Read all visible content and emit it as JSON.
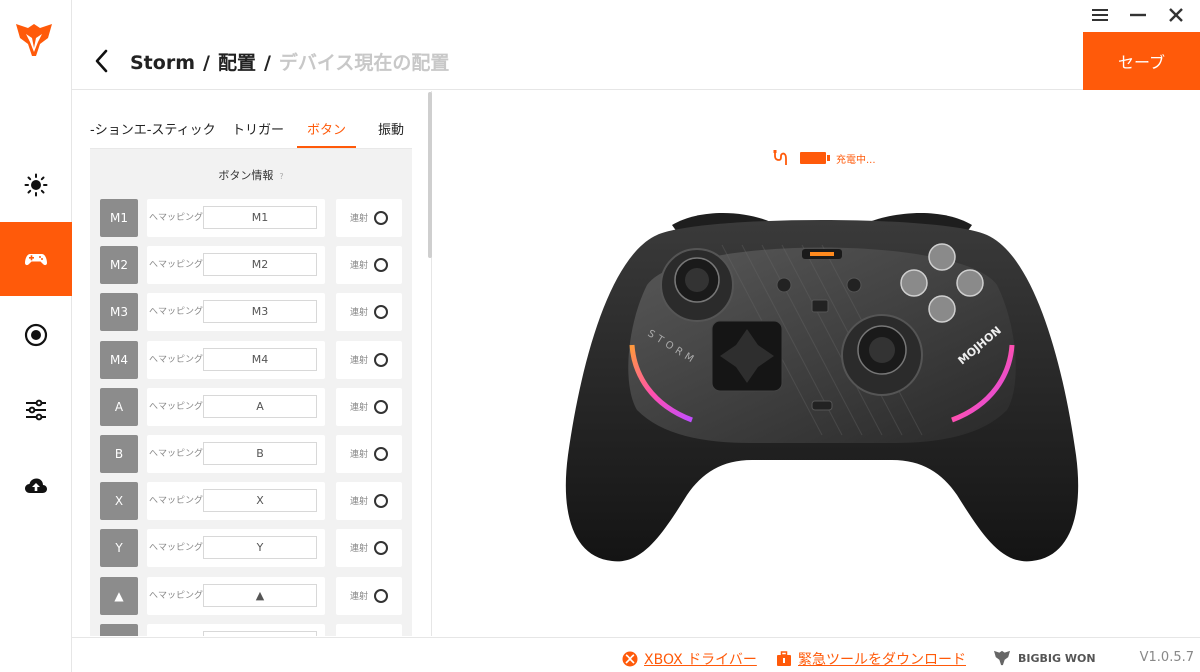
{
  "colors": {
    "accent": "#ff5a0a",
    "key_bg": "#8c8c8c",
    "panel_bg": "#f2f2f2"
  },
  "window_controls": {
    "icons": [
      "menu-icon",
      "minimize-icon",
      "close-icon"
    ]
  },
  "sidebar": {
    "items": [
      {
        "name": "lighting",
        "icon": "sun-icon",
        "active": false
      },
      {
        "name": "config",
        "icon": "gamepad-icon",
        "active": true
      },
      {
        "name": "record",
        "icon": "record-icon",
        "active": false
      },
      {
        "name": "settings",
        "icon": "sliders-icon",
        "active": false
      },
      {
        "name": "upload",
        "icon": "cloud-upload-icon",
        "active": false
      }
    ]
  },
  "header": {
    "crumbs": [
      "Storm",
      "配置",
      "デバイス現在の配置"
    ],
    "separator": "/",
    "save_label": "セーブ"
  },
  "tabs": [
    {
      "label": "-ションエ-スティック",
      "active": false
    },
    {
      "label": "トリガー",
      "active": false
    },
    {
      "label": "ボタン",
      "active": true
    },
    {
      "label": "振動",
      "active": false
    }
  ],
  "button_list": {
    "title": "ボタン情報",
    "help": "?",
    "map_label": "へマッピング",
    "turbo_label": "連射",
    "rows": [
      {
        "key": "M1",
        "mapped": "M1"
      },
      {
        "key": "M2",
        "mapped": "M2"
      },
      {
        "key": "M3",
        "mapped": "M3"
      },
      {
        "key": "M4",
        "mapped": "M4"
      },
      {
        "key": "A",
        "mapped": "A"
      },
      {
        "key": "B",
        "mapped": "B"
      },
      {
        "key": "X",
        "mapped": "X"
      },
      {
        "key": "Y",
        "mapped": "Y"
      },
      {
        "key": "▲",
        "mapped": "▲"
      },
      {
        "key": "▼",
        "mapped": "▼"
      }
    ]
  },
  "device_status": {
    "charging_text": "充電中...",
    "battery_icon": "battery-icon",
    "cable_icon": "usb-cable-icon"
  },
  "footer": {
    "xbox_driver": "XBOX ドライバー",
    "emergency_tool": "緊急ツールをダウンロード",
    "brand": "BIGBIG WON",
    "version": "V1.0.5.7"
  }
}
